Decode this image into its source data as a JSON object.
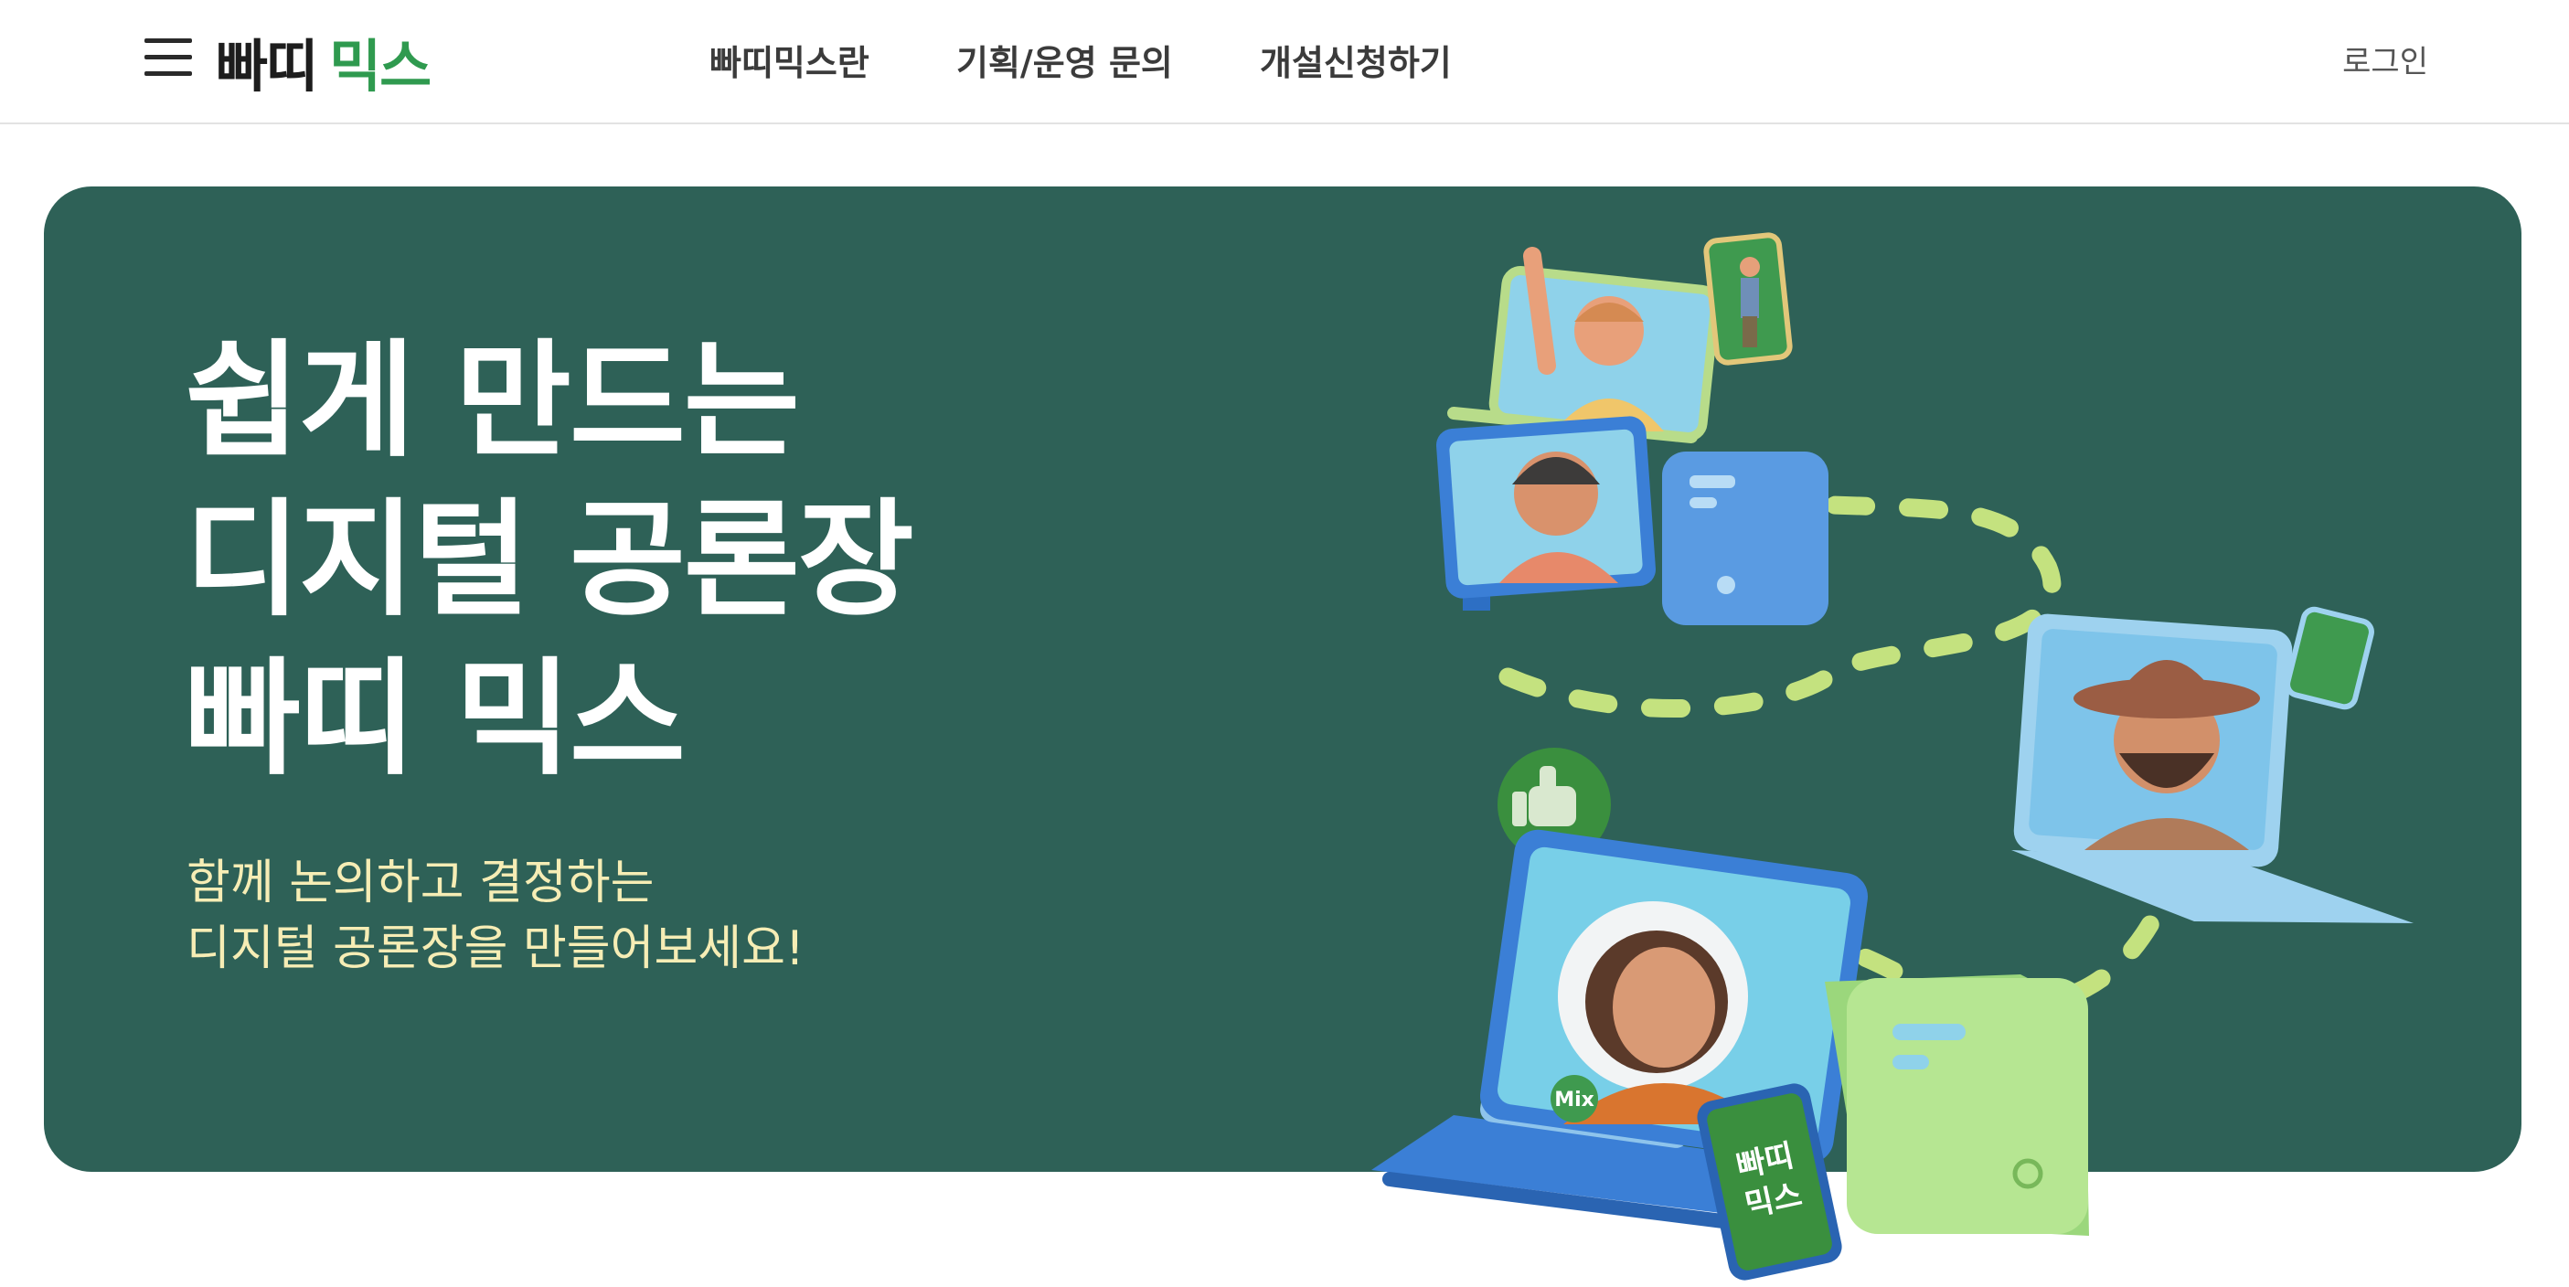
{
  "header": {
    "logo": {
      "part1": "빠띠",
      "part2": "믹스"
    },
    "nav": [
      "빠띠믹스란",
      "기획/운영 문의",
      "개설신청하기"
    ],
    "login": "로그인"
  },
  "hero": {
    "title_lines": [
      "쉽게 만드는",
      "디지털 공론장",
      "빠띠 믹스"
    ],
    "subtitle_lines": [
      "함께 논의하고 결정하는",
      "디지털 공론장을 만들어보세요!"
    ],
    "illustration": {
      "badge_mix": "Mix",
      "phone_text_line1": "빠띠",
      "phone_text_line2": "믹스"
    }
  },
  "colors": {
    "hero_bg": "#2e6157",
    "brand_green": "#2f9a4f",
    "subtitle": "#f6edb5",
    "dash": "#c4e27f"
  }
}
